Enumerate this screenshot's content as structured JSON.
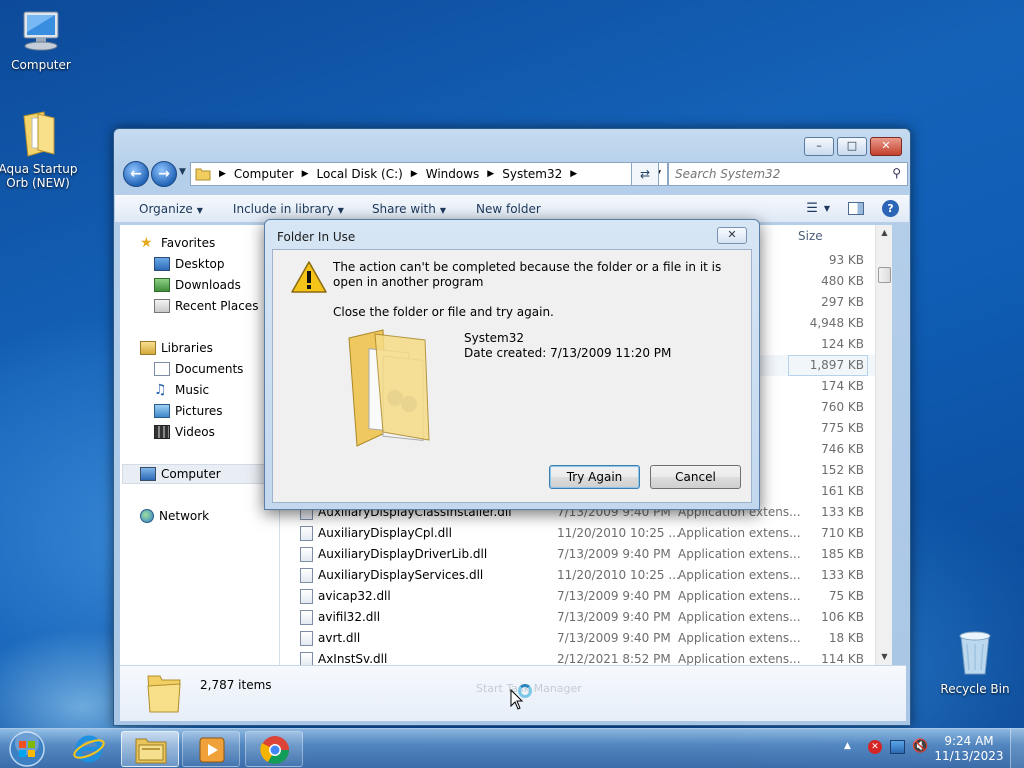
{
  "desktop": {
    "icons": [
      {
        "label": "Computer"
      },
      {
        "label": "Aqua Startup Orb (NEW)"
      },
      {
        "label": "Recycle Bin"
      }
    ]
  },
  "explorer": {
    "path": [
      "Computer",
      "Local Disk (C:)",
      "Windows",
      "System32"
    ],
    "search_placeholder": "Search System32",
    "toolbar": {
      "organize": "Organize",
      "include": "Include in library",
      "share": "Share with",
      "new_folder": "New folder"
    },
    "nav": {
      "favorites": "Favorites",
      "desktop": "Desktop",
      "downloads": "Downloads",
      "recent": "Recent Places",
      "libraries": "Libraries",
      "documents": "Documents",
      "music": "Music",
      "pictures": "Pictures",
      "videos": "Videos",
      "computer": "Computer",
      "network": "Network"
    },
    "column_size": "Size",
    "files": [
      {
        "name": "",
        "date": "",
        "type": "ens...",
        "size": "93 KB"
      },
      {
        "name": "",
        "date": "",
        "type": "ens...",
        "size": "480 KB"
      },
      {
        "name": "",
        "date": "",
        "type": "ens...",
        "size": "297 KB"
      },
      {
        "name": "",
        "date": "",
        "type": "ens...",
        "size": "4,948 KB"
      },
      {
        "name": "",
        "date": "",
        "type": "ens...",
        "size": "124 KB"
      },
      {
        "name": "",
        "date": "",
        "type": "xtens...",
        "size": "1,897 KB"
      },
      {
        "name": "",
        "date": "",
        "type": "ens...",
        "size": "174 KB"
      },
      {
        "name": "",
        "date": "",
        "type": "",
        "size": "760 KB"
      },
      {
        "name": "",
        "date": "",
        "type": "",
        "size": "775 KB"
      },
      {
        "name": "",
        "date": "",
        "type": "",
        "size": "746 KB"
      },
      {
        "name": "",
        "date": "",
        "type": "ens...",
        "size": "152 KB"
      },
      {
        "name": "",
        "date": "",
        "type": "ens...",
        "size": "161 KB"
      },
      {
        "name": "AuxiliaryDisplayClassInstaller.dll",
        "date": "7/13/2009 9:40 PM",
        "type": "Application extens...",
        "size": "133 KB"
      },
      {
        "name": "AuxiliaryDisplayCpl.dll",
        "date": "11/20/2010 10:25 ...",
        "type": "Application extens...",
        "size": "710 KB"
      },
      {
        "name": "AuxiliaryDisplayDriverLib.dll",
        "date": "7/13/2009 9:40 PM",
        "type": "Application extens...",
        "size": "185 KB"
      },
      {
        "name": "AuxiliaryDisplayServices.dll",
        "date": "11/20/2010 10:25 ...",
        "type": "Application extens...",
        "size": "133 KB"
      },
      {
        "name": "avicap32.dll",
        "date": "7/13/2009 9:40 PM",
        "type": "Application extens...",
        "size": "75 KB"
      },
      {
        "name": "avifil32.dll",
        "date": "7/13/2009 9:40 PM",
        "type": "Application extens...",
        "size": "106 KB"
      },
      {
        "name": "avrt.dll",
        "date": "7/13/2009 9:40 PM",
        "type": "Application extens...",
        "size": "18 KB"
      },
      {
        "name": "AxInstSv.dll",
        "date": "2/12/2021 8:52 PM",
        "type": "Application extens...",
        "size": "114 KB"
      }
    ],
    "item_count": "2,787 items",
    "ghost_text": "Start Task Manager"
  },
  "dialog": {
    "title": "Folder In Use",
    "message": "The action can't be completed because the folder or a file in it is open in another program",
    "instruction": "Close the folder or file and try again.",
    "folder_name": "System32",
    "date_created": "Date created: 7/13/2009 11:20 PM",
    "try_again": "Try Again",
    "cancel": "Cancel"
  },
  "taskbar": {
    "time": "9:24 AM",
    "date": "11/13/2023"
  }
}
